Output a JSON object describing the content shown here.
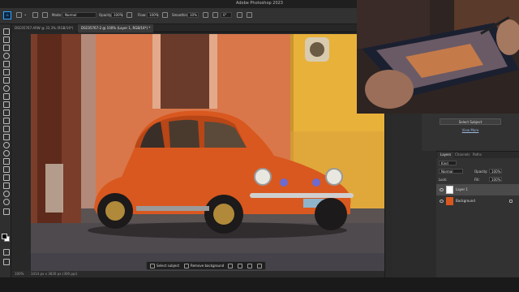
{
  "window": {
    "title": "Adobe Photoshop 2023"
  },
  "options": {
    "mode_label": "Mode:",
    "mode_value": "Normal",
    "opacity_label": "Opacity:",
    "opacity_value": "100%",
    "flow_label": "Flow:",
    "flow_value": "100%",
    "smoothing_label": "Smoothing:",
    "smoothing_value": "10%",
    "angle_value": "0°"
  },
  "tabs": [
    {
      "label": "DSC05767.ARW @ 33.3% (RGB/16*)"
    },
    {
      "label": "DSC05767-2 @ 100% (Layer 1, RGB/16*) *"
    }
  ],
  "status": {
    "zoom": "100%",
    "dims": "3414 px x 3830 px (300 ppi)"
  },
  "context_bar": {
    "select_subject": "Select subject",
    "remove_background": "Remove background"
  },
  "properties": {
    "select_subject_button": "Select Subject",
    "view_more": "View More"
  },
  "layers_panel": {
    "tabs": [
      "Layers",
      "Channels",
      "Paths"
    ],
    "kind_filter": "Kind",
    "blend_mode": "Normal",
    "opacity_label": "Opacity:",
    "opacity_value": "100%",
    "lock_label": "Lock:",
    "fill_label": "Fill:",
    "fill_value": "100%",
    "layers": [
      {
        "name": "Layer 1",
        "selected": true
      },
      {
        "name": "Background",
        "selected": false
      }
    ]
  },
  "colors": {
    "wall_orange": "#d9774a",
    "wall_yellow": "#e8b13a",
    "car_orange": "#d9581f",
    "accent": "#31a8ff"
  }
}
